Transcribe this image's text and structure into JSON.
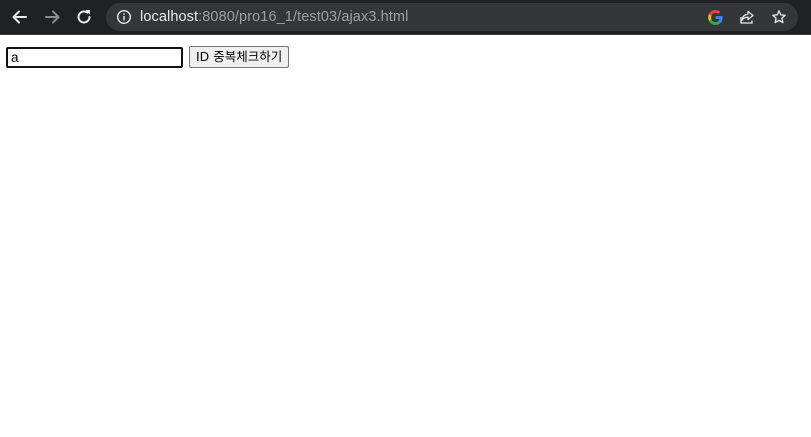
{
  "browser": {
    "url_host": "localhost",
    "url_rest": ":8080/pro16_1/test03/ajax3.html",
    "icons": {
      "back": "back-arrow-icon",
      "forward": "forward-arrow-icon",
      "reload": "reload-icon",
      "site_info": "info-icon",
      "google": "google-icon",
      "share": "share-icon",
      "bookmark": "star-icon"
    }
  },
  "form": {
    "id_value": "a",
    "check_button_label": "ID 중복체크하기"
  }
}
